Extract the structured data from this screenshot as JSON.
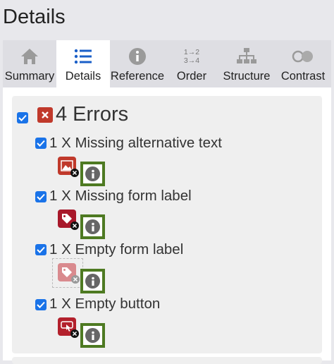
{
  "header": {
    "title": "Details"
  },
  "tabs": [
    {
      "label": "Summary",
      "icon": "home-icon"
    },
    {
      "label": "Details",
      "icon": "list-icon"
    },
    {
      "label": "Reference",
      "icon": "info-icon"
    },
    {
      "label": "Order",
      "icon": "order-icon",
      "icon_text_top": "1→2",
      "icon_text_bottom": "3→4"
    },
    {
      "label": "Structure",
      "icon": "sitemap-icon"
    },
    {
      "label": "Contrast",
      "icon": "contrast-icon"
    }
  ],
  "active_tab": "Details",
  "errors": {
    "heading": "4 Errors",
    "items": [
      {
        "label": "1 X Missing alternative text",
        "icon": "missing-alt-image-icon"
      },
      {
        "label": "1 X Missing form label",
        "icon": "missing-label-tag-icon"
      },
      {
        "label": "1 X Empty form label",
        "icon": "empty-label-tag-icon"
      },
      {
        "label": "1 X Empty button",
        "icon": "empty-button-icon"
      }
    ]
  },
  "colors": {
    "accent": "#1a73e8",
    "error": "#c0392b",
    "highlight_border": "#4e7a22",
    "tab_bg": "#dedee3",
    "active_tab_bg": "#ffffff"
  }
}
